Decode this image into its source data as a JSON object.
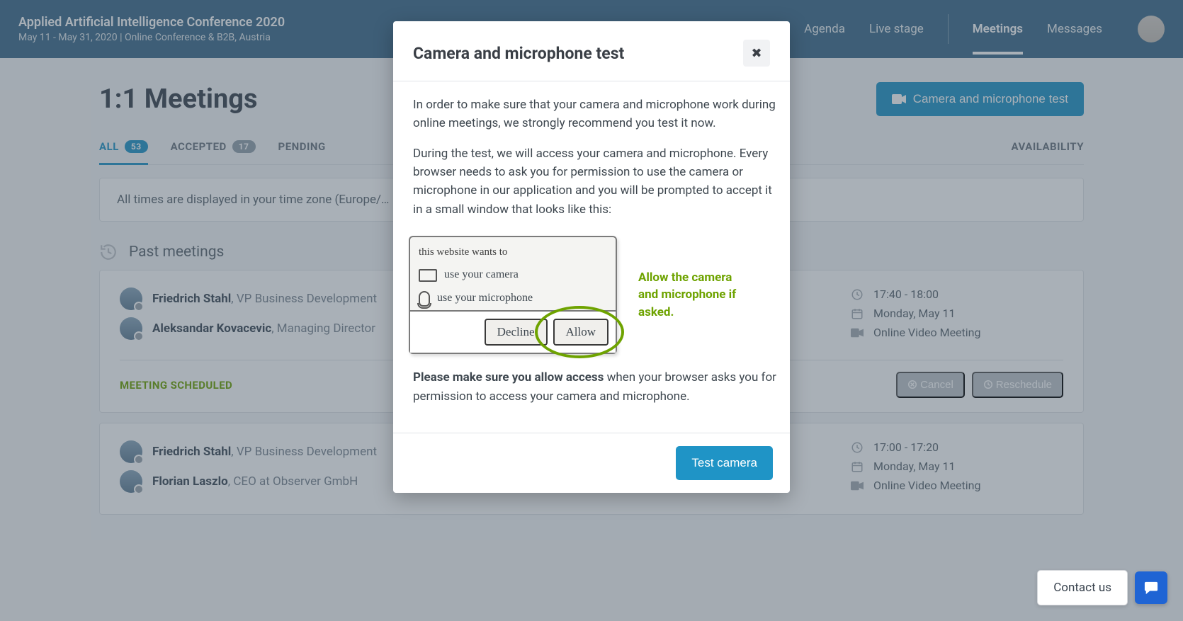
{
  "header": {
    "event_title": "Applied Artificial Intelligence Conference 2020",
    "event_sub": "May 11 - May 31, 2020  |  Online Conference & B2B, Austria"
  },
  "nav": {
    "agenda": "Agenda",
    "live_stage": "Live stage",
    "meetings": "Meetings",
    "messages": "Messages"
  },
  "page": {
    "title": "1:1 Meetings",
    "cam_test_btn": "Camera and microphone test"
  },
  "tabs": {
    "all": "ALL",
    "all_count": "53",
    "accepted": "ACCEPTED",
    "accepted_count": "17",
    "pending_prefix": "PENDING",
    "availability": "AVAILABILITY"
  },
  "tz_banner": "All times are displayed in your time zone (Europe/…",
  "sections": {
    "past": "Past meetings"
  },
  "meetings": [
    {
      "p1_name": "Friedrich Stahl",
      "p1_role": ", VP Business Development",
      "p2_name": "Aleksandar Kovacevic",
      "p2_role": ", Managing Director",
      "time": "17:40 - 18:00",
      "date": "Monday, May 11",
      "mode": "Online Video Meeting",
      "status": "MEETING SCHEDULED",
      "cancel": "Cancel",
      "reschedule": "Reschedule"
    },
    {
      "p1_name": "Friedrich Stahl",
      "p1_role": ", VP Business Development",
      "p2_name": "Florian Laszlo",
      "p2_role": ", CEO at Observer GmbH",
      "time": "17:00 - 17:20",
      "date": "Monday, May 11",
      "mode": "Online Video Meeting"
    }
  ],
  "modal": {
    "title": "Camera and microphone test",
    "p1": "In order to make sure that your camera and microphone work during online meetings, we strongly recommend you test it now.",
    "p2": "During the test, we will access your camera and microphone. Every browser needs to ask you for permission to use the camera or microphone in our application and you will be prompted to accept it in a small window that looks like this:",
    "perm_header": "this website wants to",
    "perm_cam": "use your camera",
    "perm_mic": "use your microphone",
    "perm_decline": "Decline",
    "perm_allow": "Allow",
    "perm_note": "Allow the camera and microphone if asked.",
    "p3_strong": "Please make sure you allow access",
    "p3_rest": " when your browser asks you for permission to access your camera and microphone.",
    "test_btn": "Test camera"
  },
  "contact": {
    "label": "Contact us"
  }
}
